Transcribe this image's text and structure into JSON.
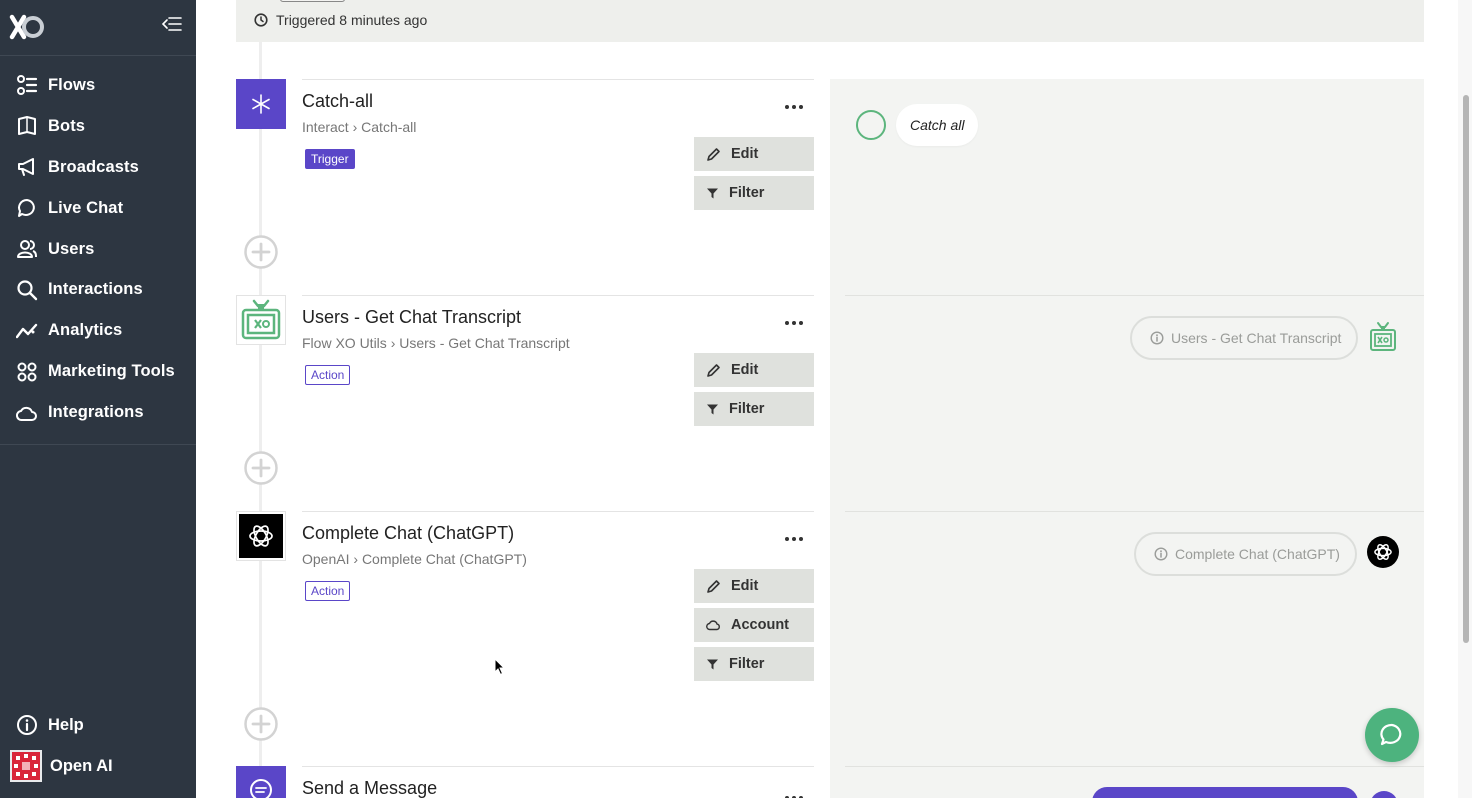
{
  "sidebar": {
    "items": [
      {
        "label": "Flows",
        "icon": "flows-icon"
      },
      {
        "label": "Bots",
        "icon": "bots-icon"
      },
      {
        "label": "Broadcasts",
        "icon": "megaphone-icon"
      },
      {
        "label": "Live Chat",
        "icon": "chat-bubble-icon"
      },
      {
        "label": "Users",
        "icon": "users-icon"
      },
      {
        "label": "Interactions",
        "icon": "search-icon"
      },
      {
        "label": "Analytics",
        "icon": "analytics-icon"
      },
      {
        "label": "Marketing Tools",
        "icon": "grid-icon"
      },
      {
        "label": "Integrations",
        "icon": "cloud-icon"
      }
    ],
    "help_label": "Help",
    "account_label": "Open AI"
  },
  "header": {
    "triggered_text": "Triggered 8 minutes ago"
  },
  "steps": [
    {
      "title": "Catch-all",
      "service": "Interact",
      "method": "Catch-all",
      "badge": "Trigger",
      "buttons": [
        "Edit",
        "Filter"
      ]
    },
    {
      "title": "Users - Get Chat Transcript",
      "service": "Flow XO Utils",
      "method": "Users - Get Chat Transcript",
      "badge": "Action",
      "buttons": [
        "Edit",
        "Filter"
      ]
    },
    {
      "title": "Complete Chat (ChatGPT)",
      "service": "OpenAI",
      "method": "Complete Chat (ChatGPT)",
      "badge": "Action",
      "buttons": [
        "Edit",
        "Account",
        "Filter"
      ]
    },
    {
      "title": "Send a Message"
    }
  ],
  "preview": {
    "catch_all_text": "Catch all",
    "pill_1": "Users - Get Chat Transcript",
    "pill_2": "Complete Chat (ChatGPT)"
  },
  "colors": {
    "sidebar_bg": "#2d3641",
    "accent_purple": "#5a46c8",
    "accent_green": "#4db37e"
  }
}
